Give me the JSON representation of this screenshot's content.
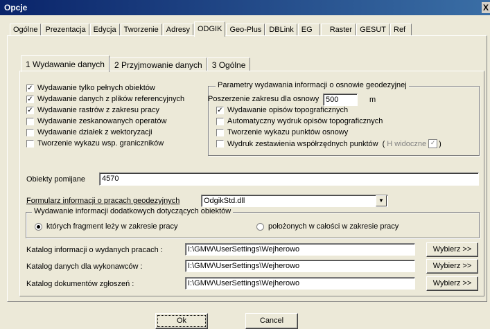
{
  "window": {
    "title": "Opcje",
    "close": "X"
  },
  "tabs": [
    {
      "label": "Ogólne"
    },
    {
      "label": "Prezentacja"
    },
    {
      "label": "Edycja"
    },
    {
      "label": "Tworzenie"
    },
    {
      "label": "Adresy"
    },
    {
      "label": "ODGIK"
    },
    {
      "label": "Geo-Plus"
    },
    {
      "label": "DBLink"
    },
    {
      "label": "EG"
    },
    {
      "label": "Raster"
    },
    {
      "label": "GESUT"
    },
    {
      "label": "Ref"
    }
  ],
  "subtabs": [
    {
      "label": "1  Wydawanie danych"
    },
    {
      "label": "2  Przyjmowanie danych"
    },
    {
      "label": "3  Ogólne"
    }
  ],
  "left_options": [
    {
      "label": "Wydawanie tylko pełnych obiektów",
      "checked": true
    },
    {
      "label": "Wydawanie danych z plików  referencyjnych",
      "checked": true
    },
    {
      "label": "Wydawanie rastrów z zakresu pracy",
      "checked": true
    },
    {
      "label": "Wydawanie zeskanowanych operatów",
      "checked": false
    },
    {
      "label": "Wydawanie działek z wektoryzacji",
      "checked": false
    },
    {
      "label": "Tworzenie wykazu wsp. graniczników",
      "checked": false
    }
  ],
  "osnowa": {
    "title": "Parametry wydawania informacji o osnowie geodezyjnej",
    "extension_label": "Poszerzenie zakresu dla osnowy",
    "extension_value": "500",
    "unit": "m",
    "options": [
      {
        "label": "Wydawanie opisów topograficznych",
        "checked": true
      },
      {
        "label": "Automatyczny wydruk opisów topograficznych",
        "checked": false
      },
      {
        "label": "Tworzenie wykazu punktów osnowy",
        "checked": false
      },
      {
        "label": "Wydruk zestawienia współrzędnych punktów",
        "checked": false
      }
    ],
    "visible_hint_open": "(",
    "visible_hint": "H widoczne",
    "visible_hint_close": ")",
    "visible_hint_check": "✓"
  },
  "skipped": {
    "label": "Obiekty pomijane",
    "value": "4570"
  },
  "form": {
    "label": "Formularz informacji o pracach geodezyjnych",
    "value": "OdgikStd.dll",
    "arrow": "▼"
  },
  "additional": {
    "title": "Wydawanie informacji dodatkowych  dotyczących obiektów",
    "options": [
      {
        "label": "których fragment leży w zakresie pracy",
        "selected": true
      },
      {
        "label": "położonych w całości w zakresie pracy",
        "selected": false
      }
    ]
  },
  "catalogs": [
    {
      "label": "Katalog informacji o wydanych pracach :",
      "value": "I:\\GMW\\UserSettings\\Wejherowo",
      "button": "Wybierz >>"
    },
    {
      "label": "Katalog danych dla wykonawców :",
      "value": "I:\\GMW\\UserSettings\\Wejherowo",
      "button": "Wybierz >>"
    },
    {
      "label": "Katalog dokumentów zgłoszeń :",
      "value": "I:\\GMW\\UserSettings\\Wejherowo",
      "button": "Wybierz >>"
    }
  ],
  "buttons": {
    "ok": "Ok",
    "cancel": "Cancel"
  }
}
